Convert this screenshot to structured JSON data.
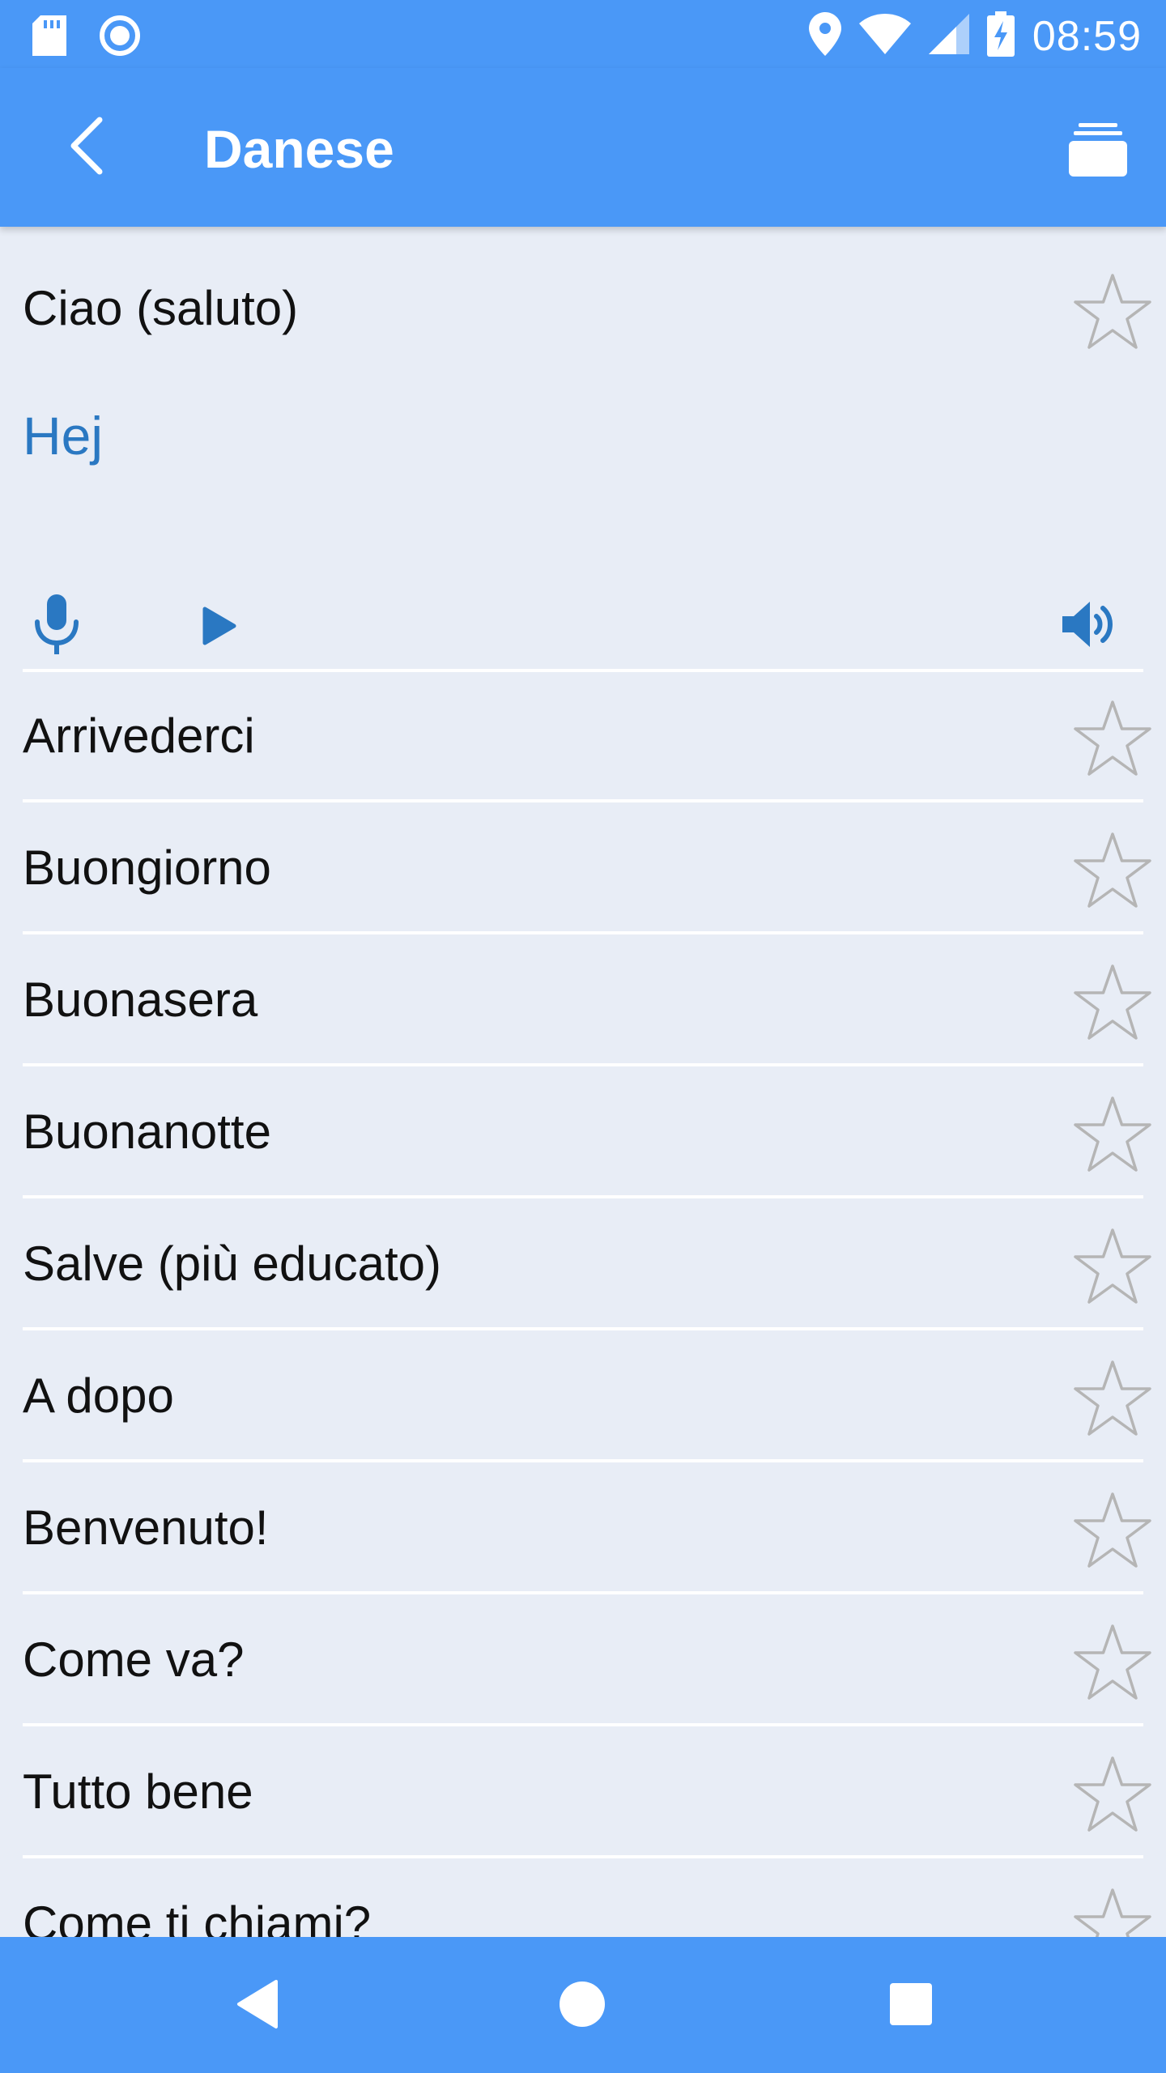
{
  "status_bar": {
    "time": "08:59",
    "left_icons": [
      "sd-card-icon",
      "circle-target-icon"
    ],
    "right_icons": [
      "location-pin-icon",
      "wifi-icon",
      "signal-icon",
      "battery-charging-icon"
    ]
  },
  "app_bar": {
    "title": "Danese",
    "back_icon": "chevron-left-icon",
    "menu_icon": "stack-layers-icon"
  },
  "featured": {
    "phrase": "Ciao (saluto)",
    "translation": "Hej",
    "favorite_icon": "star-outline-icon",
    "controls": [
      "microphone-icon",
      "play-icon",
      "speaker-volume-icon"
    ]
  },
  "phrases": [
    {
      "label": "Arrivederci"
    },
    {
      "label": "Buongiorno"
    },
    {
      "label": "Buonasera"
    },
    {
      "label": "Buonanotte"
    },
    {
      "label": "Salve (più educato)"
    },
    {
      "label": "A dopo"
    },
    {
      "label": "Benvenuto!"
    },
    {
      "label": "Come va?"
    },
    {
      "label": "Tutto bene"
    },
    {
      "label": "Come ti chiami?"
    }
  ],
  "nav_bar": {
    "icons": [
      "nav-back-triangle-icon",
      "nav-home-circle-icon",
      "nav-recents-square-icon"
    ]
  },
  "colors": {
    "primary": "#4a98f7",
    "background": "#e8edf6",
    "accent_text": "#2a78c2",
    "star_outline": "#b5b5b5"
  }
}
